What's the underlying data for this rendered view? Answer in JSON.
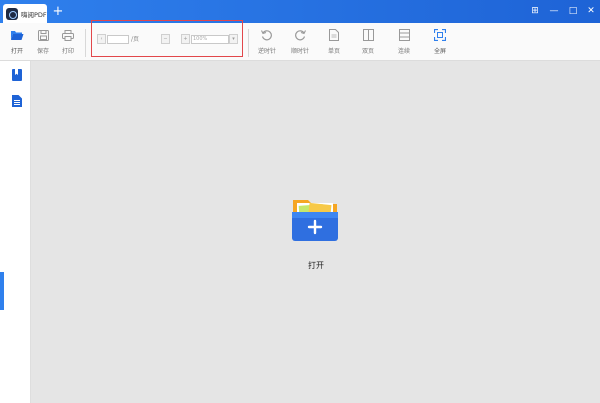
{
  "titlebar": {
    "tab_title": "嗨阅PDF",
    "new_tab": "+",
    "window_buttons": [
      "⊞",
      "—",
      "□",
      "✕"
    ]
  },
  "toolbar": {
    "open": "打开",
    "save": "保存",
    "print": "打印",
    "page_suffix": "/页",
    "zoom_value": "100%",
    "rotate_left": "逆时针",
    "rotate_right": "顺时针",
    "single_page": "单页",
    "double_page": "双页",
    "continuous": "连续",
    "fullscreen": "全屏"
  },
  "main": {
    "open_label": "打开"
  },
  "colors": {
    "titlebar": "#1e63d6",
    "accent": "#2f80ed",
    "highlight_box": "#e2474b",
    "folder_yellow": "#f7c948"
  }
}
